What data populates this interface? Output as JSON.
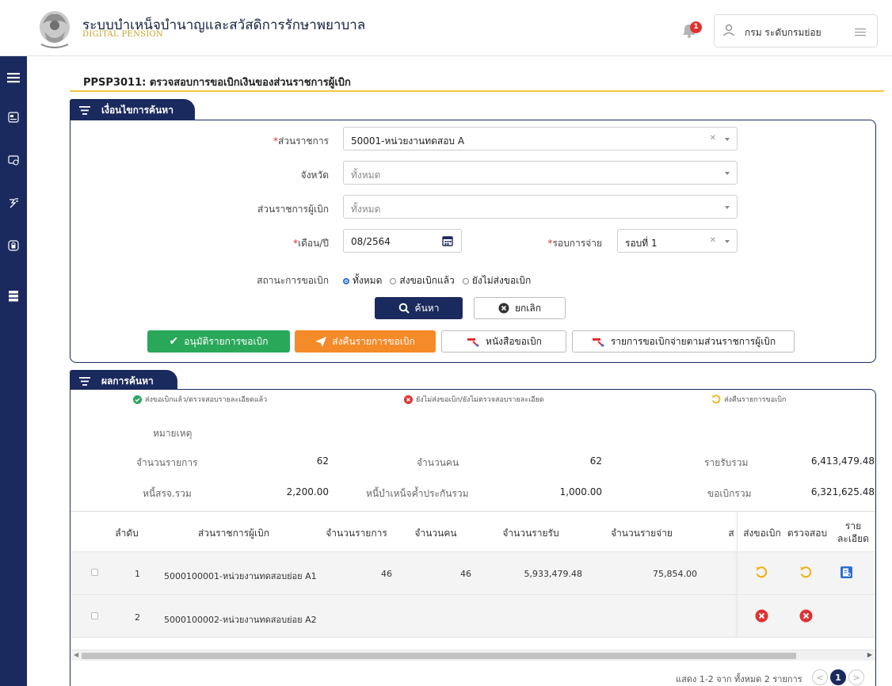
{
  "header": {
    "app_title": "ระบบบำเหน็จบำนาญและสวัสดิการรักษาพยาบาล",
    "app_subtitle": "DIGITAL PENSION",
    "notification_count": "1",
    "user_name": "กรม ระดับกรมย่อย"
  },
  "sidebar": {
    "items": [
      "menu-icon",
      "id-card-icon",
      "payment-icon",
      "cheque-icon",
      "lock-icon",
      "server-icon"
    ]
  },
  "page": {
    "title": "PPSP3011: ตรวจสอบการขอเบิกเงินของส่วนราชการผู้เบิก"
  },
  "search": {
    "section_title": "เงื่อนไขการค้นหา",
    "agency_label": "ส่วนราชการ",
    "agency_value": "50001-หน่วยงานทดสอบ A",
    "province_label": "จังหวัด",
    "province_value": "ทั้งหมด",
    "requester_label": "ส่วนราชการผู้เบิก",
    "requester_value": "ทั้งหมด",
    "period_label": "เดือน/ปี",
    "period_value": "08/2564",
    "round_label": "รอบการจ่าย",
    "round_value": "รอบที่ 1",
    "status_label": "สถานะการขอเบิก",
    "status_options": [
      "ทั้งหมด",
      "ส่งขอเบิกแล้ว",
      "ยังไม่ส่งขอเบิก"
    ],
    "search_button": "ค้นหา",
    "cancel_button": "ยกเลิก",
    "approve_button": "อนุมัติรายการขอเบิก",
    "return_button": "ส่งคืนรายการขอเบิก",
    "letter_button": "หนังสือขอเบิก",
    "report_button": "รายการขอเบิกจ่ายตามส่วนราชการผู้เบิก"
  },
  "results": {
    "section_title": "ผลการค้นหา",
    "legend": [
      "ส่งขอเบิกแล้ว/ตรวจสอบรายละเอียดแล้ว",
      "ยังไม่ส่งขอเบิก/ยังไม่ตรวจสอบรายละเอียด",
      "ส่งคืนรายการขอเบิก"
    ],
    "note_label": "หมายเหตุ",
    "stats": {
      "item_count_label": "จำนวนรายการ",
      "item_count": "62",
      "person_count_label": "จำนวนคน",
      "person_count": "62",
      "income_total_label": "รายรับรวม",
      "income_total": "6,413,479.48",
      "debt_label": "หนี้สรจ.รวม",
      "debt_value": "2,200.00",
      "pension_debt_label": "หนี้บำเหน็จค้ำประกันรวม",
      "pension_debt_value": "1,000.00",
      "claim_total_label": "ขอเบิกรวม",
      "claim_total": "6,321,625.48"
    },
    "columns": [
      "ลำดับ",
      "ส่วนราชการผู้เบิก",
      "จำนวนรายการ",
      "จำนวนคน",
      "จำนวนรายรับ",
      "จำนวนรายจ่าย",
      "ส",
      "ส่งขอเบิก",
      "ตรวจสอบ",
      "ราย",
      "ละเอียด"
    ],
    "rows": [
      {
        "no": "1",
        "agency": "5000100001-หน่วยงานทดสอบย่อย A1",
        "items": "46",
        "persons": "46",
        "income": "5,933,479.48",
        "expense": "75,854.00",
        "submit_status": "returned-icon",
        "check_status": "returned-icon",
        "detail": "document-icon"
      },
      {
        "no": "2",
        "agency": "5000100002-หน่วยงานทดสอบย่อย A2",
        "items": "",
        "persons": "",
        "income": "",
        "expense": "",
        "submit_status": "not-submitted-icon",
        "check_status": "not-submitted-icon",
        "detail": ""
      }
    ],
    "pagination": {
      "info": "แสดง 1-2 จาก ทั้งหมด 2 รายการ",
      "current_page": "1",
      "prev": "<",
      "next": ">"
    }
  },
  "colors": {
    "navy": "#1b2a5e",
    "gold": "#f2c744",
    "green": "#2aa85a",
    "orange": "#f58a28",
    "red": "#e0302f",
    "blue": "#2d6fd6"
  }
}
